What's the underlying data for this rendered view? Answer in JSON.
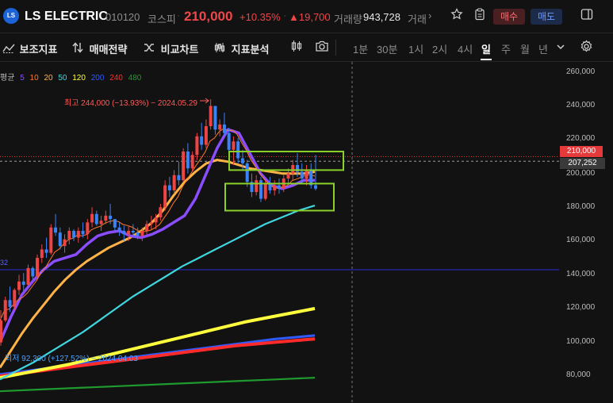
{
  "header": {
    "logo_text": "LS",
    "name": "LS ELECTRIC",
    "code": "010120",
    "market": "코스피",
    "price": "210,000",
    "change_pct": "+10.35%",
    "change": "▲19,700",
    "volume_label": "거래량",
    "volume": "943,728",
    "more_label": "거래",
    "more_arrow": "›",
    "buy_label": "매수",
    "sell_label": "매도",
    "icons": [
      "star-icon",
      "clipboard-icon",
      "sidebar-icon"
    ]
  },
  "toolbar": {
    "items": [
      {
        "icon": "indicator-icon",
        "label": "보조지표"
      },
      {
        "icon": "strategy-icon",
        "label": "매매전략"
      },
      {
        "icon": "compare-icon",
        "label": "비교차트"
      },
      {
        "icon": "analysis-icon",
        "label": "지표분석"
      }
    ],
    "periods": [
      "1분",
      "30분",
      "1시",
      "2시",
      "4시",
      "일",
      "주",
      "월",
      "년"
    ],
    "active_period": "일",
    "icons": [
      "candle-icon",
      "camera-icon",
      "chevron-down-icon",
      "gear-icon"
    ]
  },
  "chart_data": {
    "type": "line",
    "ma_legend": {
      "label": "평균",
      "items": [
        {
          "period": "5",
          "color": "#8a4dff"
        },
        {
          "period": "10",
          "color": "#ff7a2a"
        },
        {
          "period": "20",
          "color": "#ffb347"
        },
        {
          "period": "50",
          "color": "#3fd6e0"
        },
        {
          "period": "120",
          "color": "#ffff3d"
        },
        {
          "period": "200",
          "color": "#2f5bff"
        },
        {
          "period": "240",
          "color": "#ff2b2b"
        },
        {
          "period": "480",
          "color": "#1f9a2e"
        }
      ]
    },
    "high_annotation": "최고 244,000 (−13.93%) − 2024.05.29",
    "low_annotation": "최저 92,300 (+127.52%) − 2024.04.03",
    "left_edge_label": "32",
    "ylim": [
      70000,
      265000
    ],
    "y_ticks": [
      260000,
      240000,
      220000,
      200000,
      180000,
      160000,
      140000,
      120000,
      100000,
      80000
    ],
    "y_tick_labels": [
      "260,000",
      "240,000",
      "220,000",
      "200,000",
      "180,000",
      "160,000",
      "140,000",
      "120,000",
      "100,000",
      "80,000"
    ],
    "current_price": 210000,
    "current_price_label": "210,000",
    "cursor_price": 207252,
    "cursor_price_label": "207,252",
    "horizontal_line": 143000,
    "candles": [
      [
        100,
        119,
        98,
        113
      ],
      [
        113,
        127,
        112,
        125
      ],
      [
        125,
        133,
        118,
        121
      ],
      [
        121,
        132,
        119,
        131
      ],
      [
        131,
        140,
        128,
        136
      ],
      [
        136,
        141,
        130,
        134
      ],
      [
        134,
        146,
        132,
        144
      ],
      [
        144,
        145,
        137,
        139
      ],
      [
        139,
        152,
        138,
        150
      ],
      [
        150,
        158,
        147,
        155
      ],
      [
        155,
        162,
        150,
        153
      ],
      [
        153,
        170,
        152,
        168
      ],
      [
        168,
        176,
        163,
        165
      ],
      [
        165,
        168,
        155,
        157
      ],
      [
        157,
        164,
        153,
        161
      ],
      [
        161,
        168,
        158,
        166
      ],
      [
        166,
        167,
        160,
        162
      ],
      [
        162,
        168,
        159,
        166
      ],
      [
        166,
        171,
        162,
        164
      ],
      [
        164,
        173,
        161,
        171
      ],
      [
        171,
        180,
        168,
        176
      ],
      [
        176,
        178,
        169,
        170
      ],
      [
        170,
        175,
        166,
        172
      ],
      [
        172,
        178,
        170,
        175
      ],
      [
        175,
        182,
        170,
        173
      ],
      [
        173,
        172,
        166,
        168
      ],
      [
        168,
        171,
        163,
        166
      ],
      [
        166,
        169,
        160,
        164
      ],
      [
        164,
        169,
        160,
        166
      ],
      [
        166,
        170,
        162,
        165
      ],
      [
        165,
        168,
        161,
        163
      ],
      [
        163,
        168,
        160,
        166
      ],
      [
        166,
        172,
        164,
        170
      ],
      [
        170,
        175,
        167,
        171
      ],
      [
        171,
        176,
        167,
        174
      ],
      [
        174,
        182,
        172,
        180
      ],
      [
        180,
        196,
        178,
        193
      ],
      [
        193,
        198,
        186,
        190
      ],
      [
        190,
        202,
        188,
        199
      ],
      [
        199,
        207,
        193,
        196
      ],
      [
        196,
        215,
        195,
        213
      ],
      [
        213,
        218,
        200,
        203
      ],
      [
        203,
        213,
        201,
        211
      ],
      [
        211,
        224,
        208,
        222
      ],
      [
        222,
        230,
        214,
        217
      ],
      [
        217,
        232,
        215,
        228
      ],
      [
        228,
        244,
        226,
        240
      ],
      [
        240,
        236,
        223,
        226
      ],
      [
        226,
        232,
        222,
        229
      ],
      [
        229,
        236,
        222,
        224
      ],
      [
        224,
        227,
        210,
        214
      ],
      [
        214,
        222,
        205,
        219
      ],
      [
        219,
        221,
        206,
        209
      ],
      [
        209,
        214,
        202,
        206
      ],
      [
        206,
        208,
        192,
        195
      ],
      [
        195,
        200,
        186,
        189
      ],
      [
        189,
        199,
        187,
        196
      ],
      [
        196,
        198,
        183,
        185
      ],
      [
        185,
        196,
        184,
        194
      ],
      [
        194,
        198,
        188,
        190
      ],
      [
        190,
        196,
        187,
        193
      ],
      [
        193,
        197,
        188,
        191
      ],
      [
        191,
        199,
        189,
        197
      ],
      [
        197,
        203,
        193,
        200
      ],
      [
        200,
        208,
        196,
        205
      ],
      [
        205,
        212,
        198,
        201
      ],
      [
        201,
        206,
        194,
        197
      ],
      [
        197,
        205,
        193,
        202
      ],
      [
        202,
        206,
        191,
        193
      ],
      [
        193,
        211,
        190,
        191
      ]
    ],
    "ma_series": {
      "ma5": [
        100,
        115,
        128,
        136,
        143,
        148,
        150,
        152,
        158,
        163,
        165,
        166,
        163,
        162,
        164,
        167,
        171,
        175,
        185,
        200,
        215,
        226,
        224,
        212,
        200,
        193,
        191,
        193,
        196,
        196
      ],
      "ma20": [
        85,
        95,
        105,
        114,
        122,
        130,
        137,
        143,
        148,
        152,
        156,
        159,
        162,
        166,
        171,
        178,
        187,
        195,
        201,
        206,
        208,
        207,
        205,
        203,
        202,
        201,
        200,
        200,
        200,
        201
      ],
      "ma50": [
        78,
        83,
        88,
        94,
        100,
        106,
        113,
        120,
        127,
        133,
        139,
        145,
        150,
        155,
        160,
        165,
        170,
        174,
        178,
        181
      ],
      "ma120": [
        79,
        83,
        87,
        92,
        97,
        102,
        107,
        112,
        116,
        120
      ],
      "ma200": [
        81,
        84,
        87,
        90,
        93,
        96,
        99,
        102,
        104
      ],
      "ma240": [
        80,
        83,
        86,
        89,
        92,
        95,
        98,
        100,
        102
      ],
      "ma480": [
        71,
        72,
        73,
        74,
        75,
        76,
        77,
        78,
        79
      ]
    },
    "boxes": [
      {
        "from": 213000,
        "to": 202000,
        "color": "#8ad12a"
      },
      {
        "from": 194000,
        "to": 178000,
        "color": "#8ad12a"
      }
    ]
  }
}
